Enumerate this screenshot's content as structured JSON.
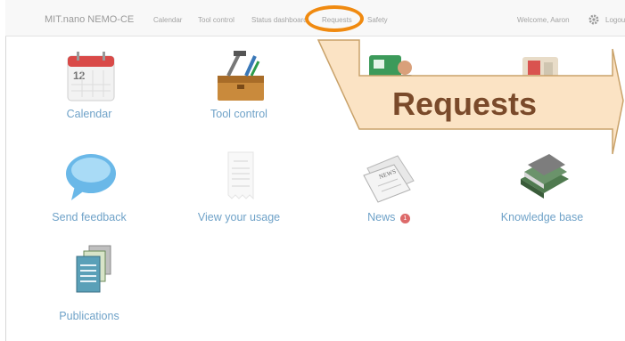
{
  "navbar": {
    "brand": "MIT.nano NEMO-CE",
    "links": [
      {
        "label": "Calendar"
      },
      {
        "label": "Tool control"
      },
      {
        "label": "Status dashboard"
      },
      {
        "label": "Requests"
      },
      {
        "label": "Safety"
      }
    ],
    "welcome": "Welcome, Aaron",
    "logout": "Logout"
  },
  "tiles": [
    {
      "label": "Calendar",
      "icon": "calendar-icon"
    },
    {
      "label": "Tool control",
      "icon": "toolbox-icon"
    },
    {
      "label": "Send feedback",
      "icon": "speech-bubble-icon"
    },
    {
      "label": "View your usage",
      "icon": "receipt-icon"
    },
    {
      "label": "News",
      "icon": "newspaper-icon",
      "badge": "1"
    },
    {
      "label": "Knowledge base",
      "icon": "books-icon"
    },
    {
      "label": "Publications",
      "icon": "documents-icon"
    }
  ],
  "callout": {
    "text": "Requests"
  },
  "colors": {
    "highlight": "#f08a10",
    "callout_fill": "#fbe3c4",
    "link": "#6fa2c8"
  }
}
